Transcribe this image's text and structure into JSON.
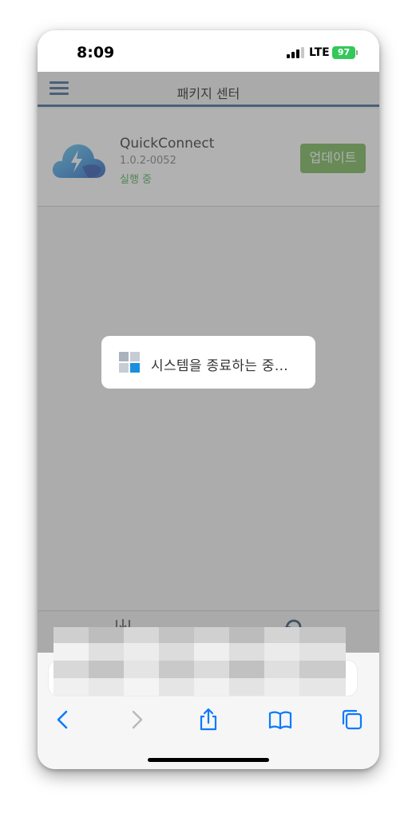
{
  "status_bar": {
    "time": "8:09",
    "network": "LTE",
    "battery": "97"
  },
  "app": {
    "title": "패키지 센터",
    "menu_icon": "hamburger-menu-icon",
    "package": {
      "name": "QuickConnect",
      "version": "1.0.2-0052",
      "status": "실행 중",
      "icon": "cloud-lightning-icon"
    },
    "update_button": "업데이트",
    "footer": {
      "install_icon": "manual-install-icon",
      "refresh_icon": "refresh-icon"
    }
  },
  "dialog": {
    "message": "시스템을 종료하는 중..."
  },
  "safari": {
    "back_icon": "chevron-left-icon",
    "forward_icon": "chevron-right-icon",
    "share_icon": "share-icon",
    "bookmarks_icon": "book-icon",
    "tabs_icon": "tabs-icon"
  },
  "colors": {
    "accent_blue": "#2f5c8f",
    "update_green": "#6ab14a",
    "status_green": "#3ba84a",
    "safari_blue": "#0a7aff",
    "battery_green": "#34c759"
  }
}
